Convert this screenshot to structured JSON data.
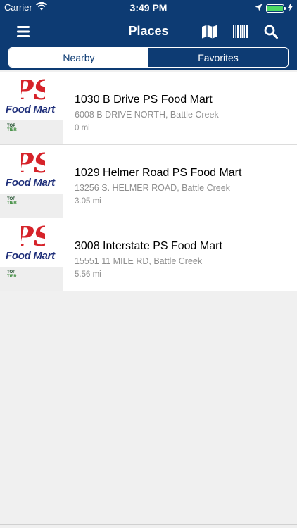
{
  "status_bar": {
    "carrier": "Carrier",
    "time": "3:49 PM"
  },
  "navbar": {
    "title": "Places",
    "icons": [
      "menu-icon",
      "map-icon",
      "barcode-icon",
      "search-icon"
    ]
  },
  "tabs": [
    {
      "label": "Nearby",
      "selected": true
    },
    {
      "label": "Favorites",
      "selected": false
    }
  ],
  "places": [
    {
      "name": "1030 B Drive PS Food Mart",
      "address": "6008 B DRIVE NORTH, Battle Creek",
      "distance": "0 mi",
      "logo_ps": "PS",
      "logo_text": "Food Mart",
      "badge_top": "TOP",
      "badge_tier": "TIER"
    },
    {
      "name": "1029 Helmer Road PS Food Mart",
      "address": "13256 S. HELMER ROAD, Battle Creek",
      "distance": "3.05 mi",
      "logo_ps": "PS",
      "logo_text": "Food Mart",
      "badge_top": "TOP",
      "badge_tier": "TIER"
    },
    {
      "name": "3008 Interstate PS Food Mart",
      "address": "15551 11 MILE RD, Battle Creek",
      "distance": "5.56 mi",
      "logo_ps": "PS",
      "logo_text": "Food Mart",
      "badge_top": "TOP",
      "badge_tier": "TIER"
    }
  ],
  "colors": {
    "navbar": "#0d3b73",
    "logo_red": "#d6232a",
    "logo_blue": "#1f2f7a",
    "battery": "#4cd964"
  }
}
